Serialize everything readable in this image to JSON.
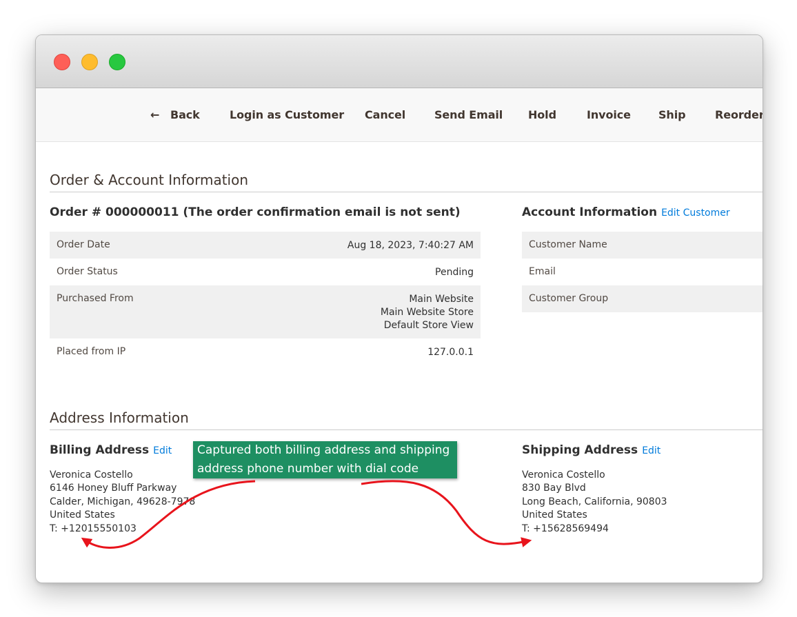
{
  "toolbar": {
    "back": "Back",
    "login_as_customer": "Login as Customer",
    "cancel": "Cancel",
    "send_email": "Send Email",
    "hold": "Hold",
    "invoice": "Invoice",
    "ship": "Ship",
    "reorder": "Reorder"
  },
  "order_account": {
    "section_title": "Order & Account Information",
    "order_heading": "Order # 000000011 (The order confirmation email is not sent)",
    "rows": [
      {
        "label": "Order Date",
        "value": "Aug 18, 2023, 7:40:27 AM"
      },
      {
        "label": "Order Status",
        "value": "Pending"
      },
      {
        "label": "Purchased From",
        "value_lines": [
          "Main Website",
          "Main Website Store",
          "Default Store View"
        ]
      },
      {
        "label": "Placed from IP",
        "value": "127.0.0.1"
      }
    ],
    "account_heading": "Account Information",
    "edit_customer": "Edit Customer",
    "account_rows": [
      {
        "label": "Customer Name"
      },
      {
        "label": "Email"
      },
      {
        "label": "Customer Group"
      }
    ]
  },
  "address": {
    "section_title": "Address Information",
    "billing": {
      "heading": "Billing Address",
      "edit": "Edit",
      "lines": [
        "Veronica Costello",
        "6146 Honey Bluff Parkway",
        "Calder, Michigan, 49628-7978",
        "United States",
        "T: +12015550103"
      ]
    },
    "shipping": {
      "heading": "Shipping Address",
      "edit": "Edit",
      "lines": [
        "Veronica Costello",
        "830 Bay Blvd",
        "Long Beach, California, 90803",
        "United States",
        "T: +15628569494"
      ]
    }
  },
  "annotation": {
    "line1": "Captured both billing address and shipping",
    "line2": "address phone number with dial code",
    "callout_color": "#1e8f62",
    "arrow_color": "#e8141c"
  }
}
